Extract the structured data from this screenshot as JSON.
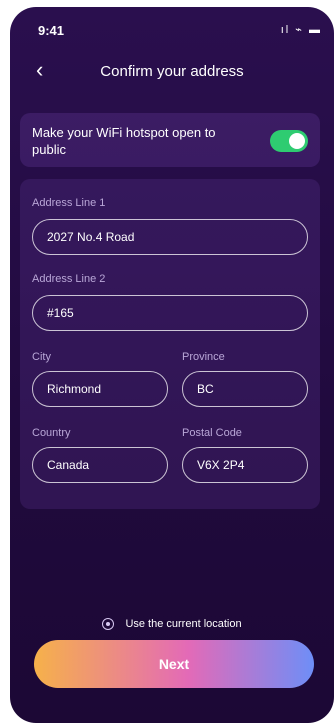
{
  "status_bar": {
    "time": "9:41",
    "icons": "ıl ⌁ ▬"
  },
  "header": {
    "title": "Confirm your address"
  },
  "hotspot": {
    "text": "Make your WiFi hotspot open to public",
    "toggle_on": true
  },
  "form": {
    "address_line1": {
      "label": "Address Line 1",
      "value": "2027 No.4 Road"
    },
    "address_line2": {
      "label": "Address Line 2",
      "value": "#165"
    },
    "city": {
      "label": "City",
      "value": "Richmond"
    },
    "province": {
      "label": "Province",
      "value": "BC"
    },
    "country": {
      "label": "Country",
      "value": "Canada"
    },
    "postal_code": {
      "label": "Postal Code",
      "value": "V6X 2P4"
    }
  },
  "location": {
    "label": "Use the current location",
    "icon": "location-icon"
  },
  "buttons": {
    "next": "Next"
  },
  "colors": {
    "toggle": "#2ecc71",
    "gradient_start": "#f6b14a",
    "gradient_mid": "#e36ab7",
    "gradient_end": "#6e8ef7"
  }
}
